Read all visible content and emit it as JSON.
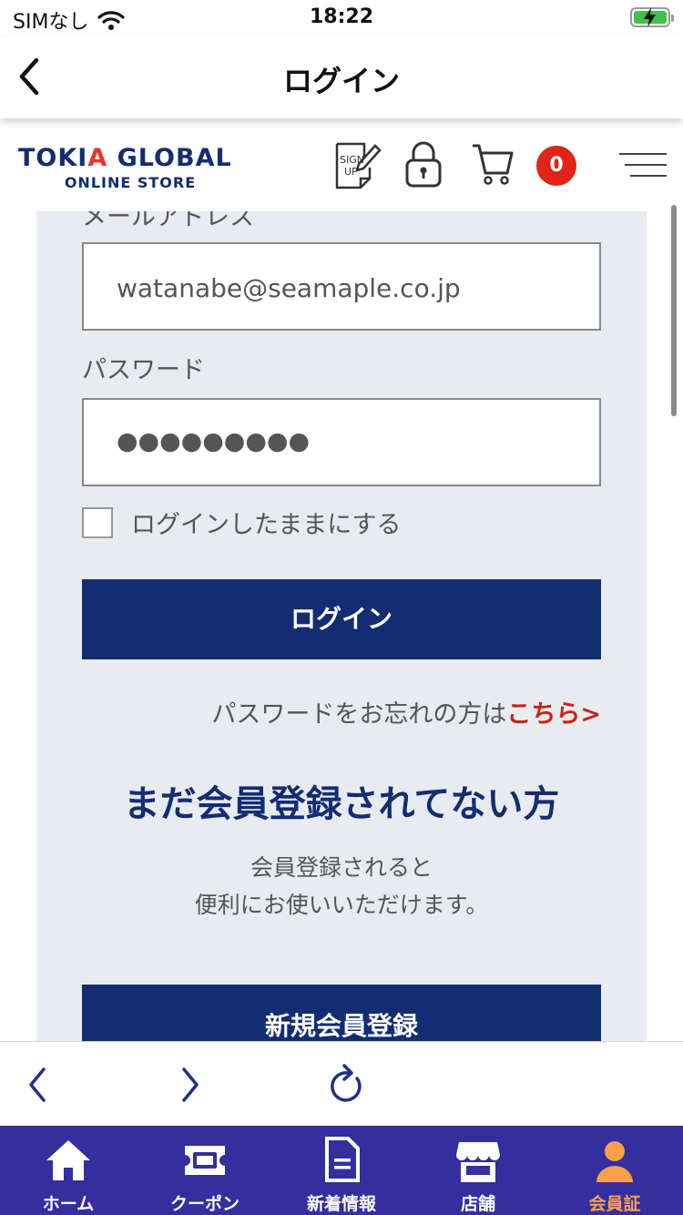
{
  "status_bar": {
    "carrier": "SIMなし",
    "time": "18:22"
  },
  "nav": {
    "title": "ログイン"
  },
  "header": {
    "logo_main_1": "TOKI",
    "logo_main_a": "A",
    "logo_main_2": " GLOBAL",
    "logo_sub": "ONLINE STORE",
    "cart_count": "0",
    "icons": [
      "sign-up-icon",
      "lock-icon",
      "cart-icon",
      "menu-icon"
    ]
  },
  "form": {
    "email_label_partial": "メールアドレス",
    "email_value": "watanabe@seamaple.co.jp",
    "password_label": "パスワード",
    "password_masked": "●●●●●●●●●",
    "remember_label": "ログインしたままにする",
    "login_button": "ログイン",
    "forgot_text": "パスワードをお忘れの方は",
    "forgot_link": "こちら>"
  },
  "register": {
    "title": "まだ会員登録されてない方",
    "desc_line1": "会員登録されると",
    "desc_line2": "便利にお使いいただけます。",
    "button": "新規会員登録"
  },
  "tabs": [
    {
      "label": "ホーム",
      "icon": "home-icon"
    },
    {
      "label": "クーポン",
      "icon": "coupon-icon"
    },
    {
      "label": "新着情報",
      "icon": "news-icon"
    },
    {
      "label": "店舗",
      "icon": "store-icon"
    },
    {
      "label": "会員証",
      "icon": "member-icon",
      "active": true
    }
  ],
  "colors": {
    "brand_navy": "#132d72",
    "accent_red": "#e23a2a",
    "tab_bg": "#342e9e",
    "tab_active": "#f6a14a",
    "panel_bg": "#e8ebf0"
  }
}
